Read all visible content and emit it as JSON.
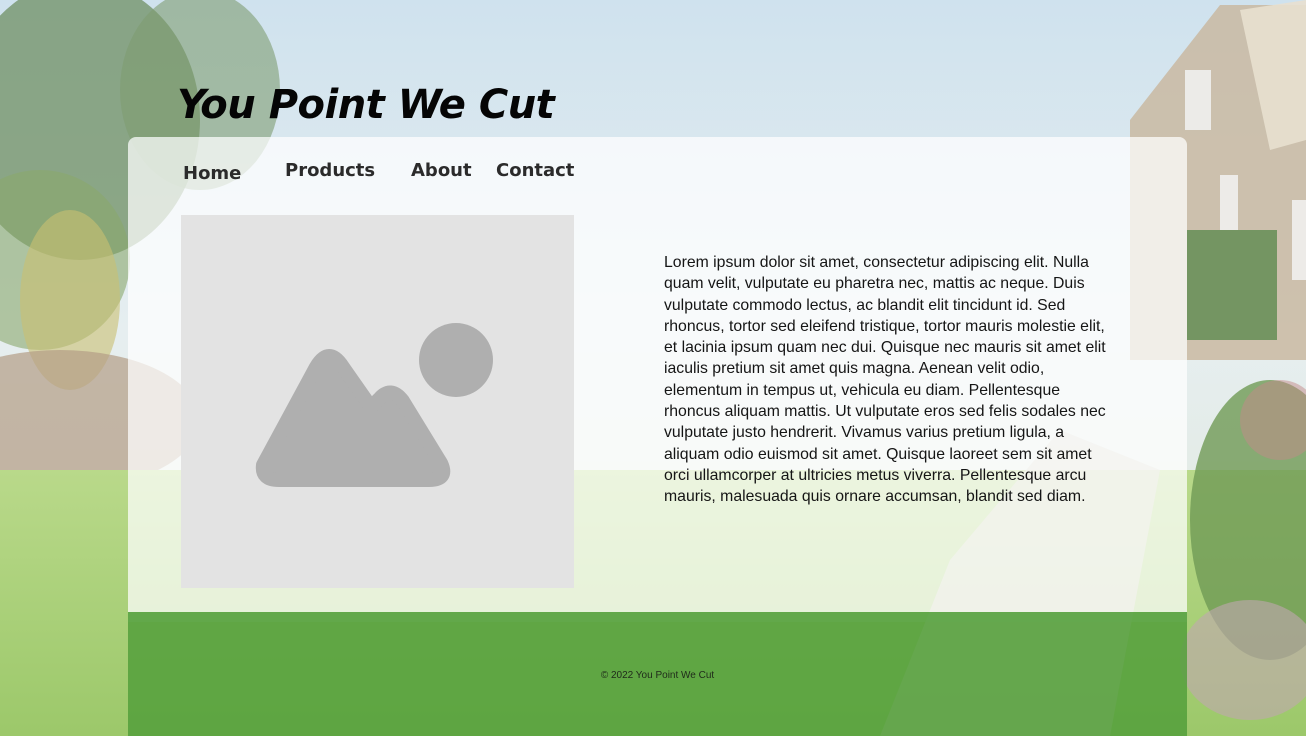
{
  "site": {
    "title": "You Point We Cut"
  },
  "nav": {
    "items": [
      {
        "label": "Home"
      },
      {
        "label": "Products"
      },
      {
        "label": "About"
      },
      {
        "label": "Contact"
      }
    ]
  },
  "main": {
    "image_icon": "image-placeholder-icon",
    "paragraph": "Lorem ipsum dolor sit amet, consectetur adipiscing elit. Nulla quam velit, vulputate eu pharetra nec, mattis ac neque. Duis vulputate commodo lectus, ac blandit elit tincidunt id. Sed rhoncus, tortor sed eleifend tristique, tortor mauris molestie elit, et lacinia ipsum quam nec dui. Quisque nec mauris sit amet elit iaculis pretium sit amet quis magna. Aenean velit odio, elementum in tempus ut, vehicula eu diam. Pellentesque rhoncus aliquam mattis. Ut vulputate eros sed felis sodales nec vulputate justo hendrerit. Vivamus varius pretium ligula, a aliquam odio euismod sit amet. Quisque laoreet sem sit amet orci ullamcorper at ultricies metus viverra. Pellentesque arcu mauris, malesuada quis ornare accumsan, blandit sed diam."
  },
  "footer": {
    "copyright": "© 2022 You Point We Cut"
  },
  "colors": {
    "footer_green": "#529e3a",
    "placeholder_bg": "#e3e3e3",
    "placeholder_fg": "#afafaf"
  }
}
